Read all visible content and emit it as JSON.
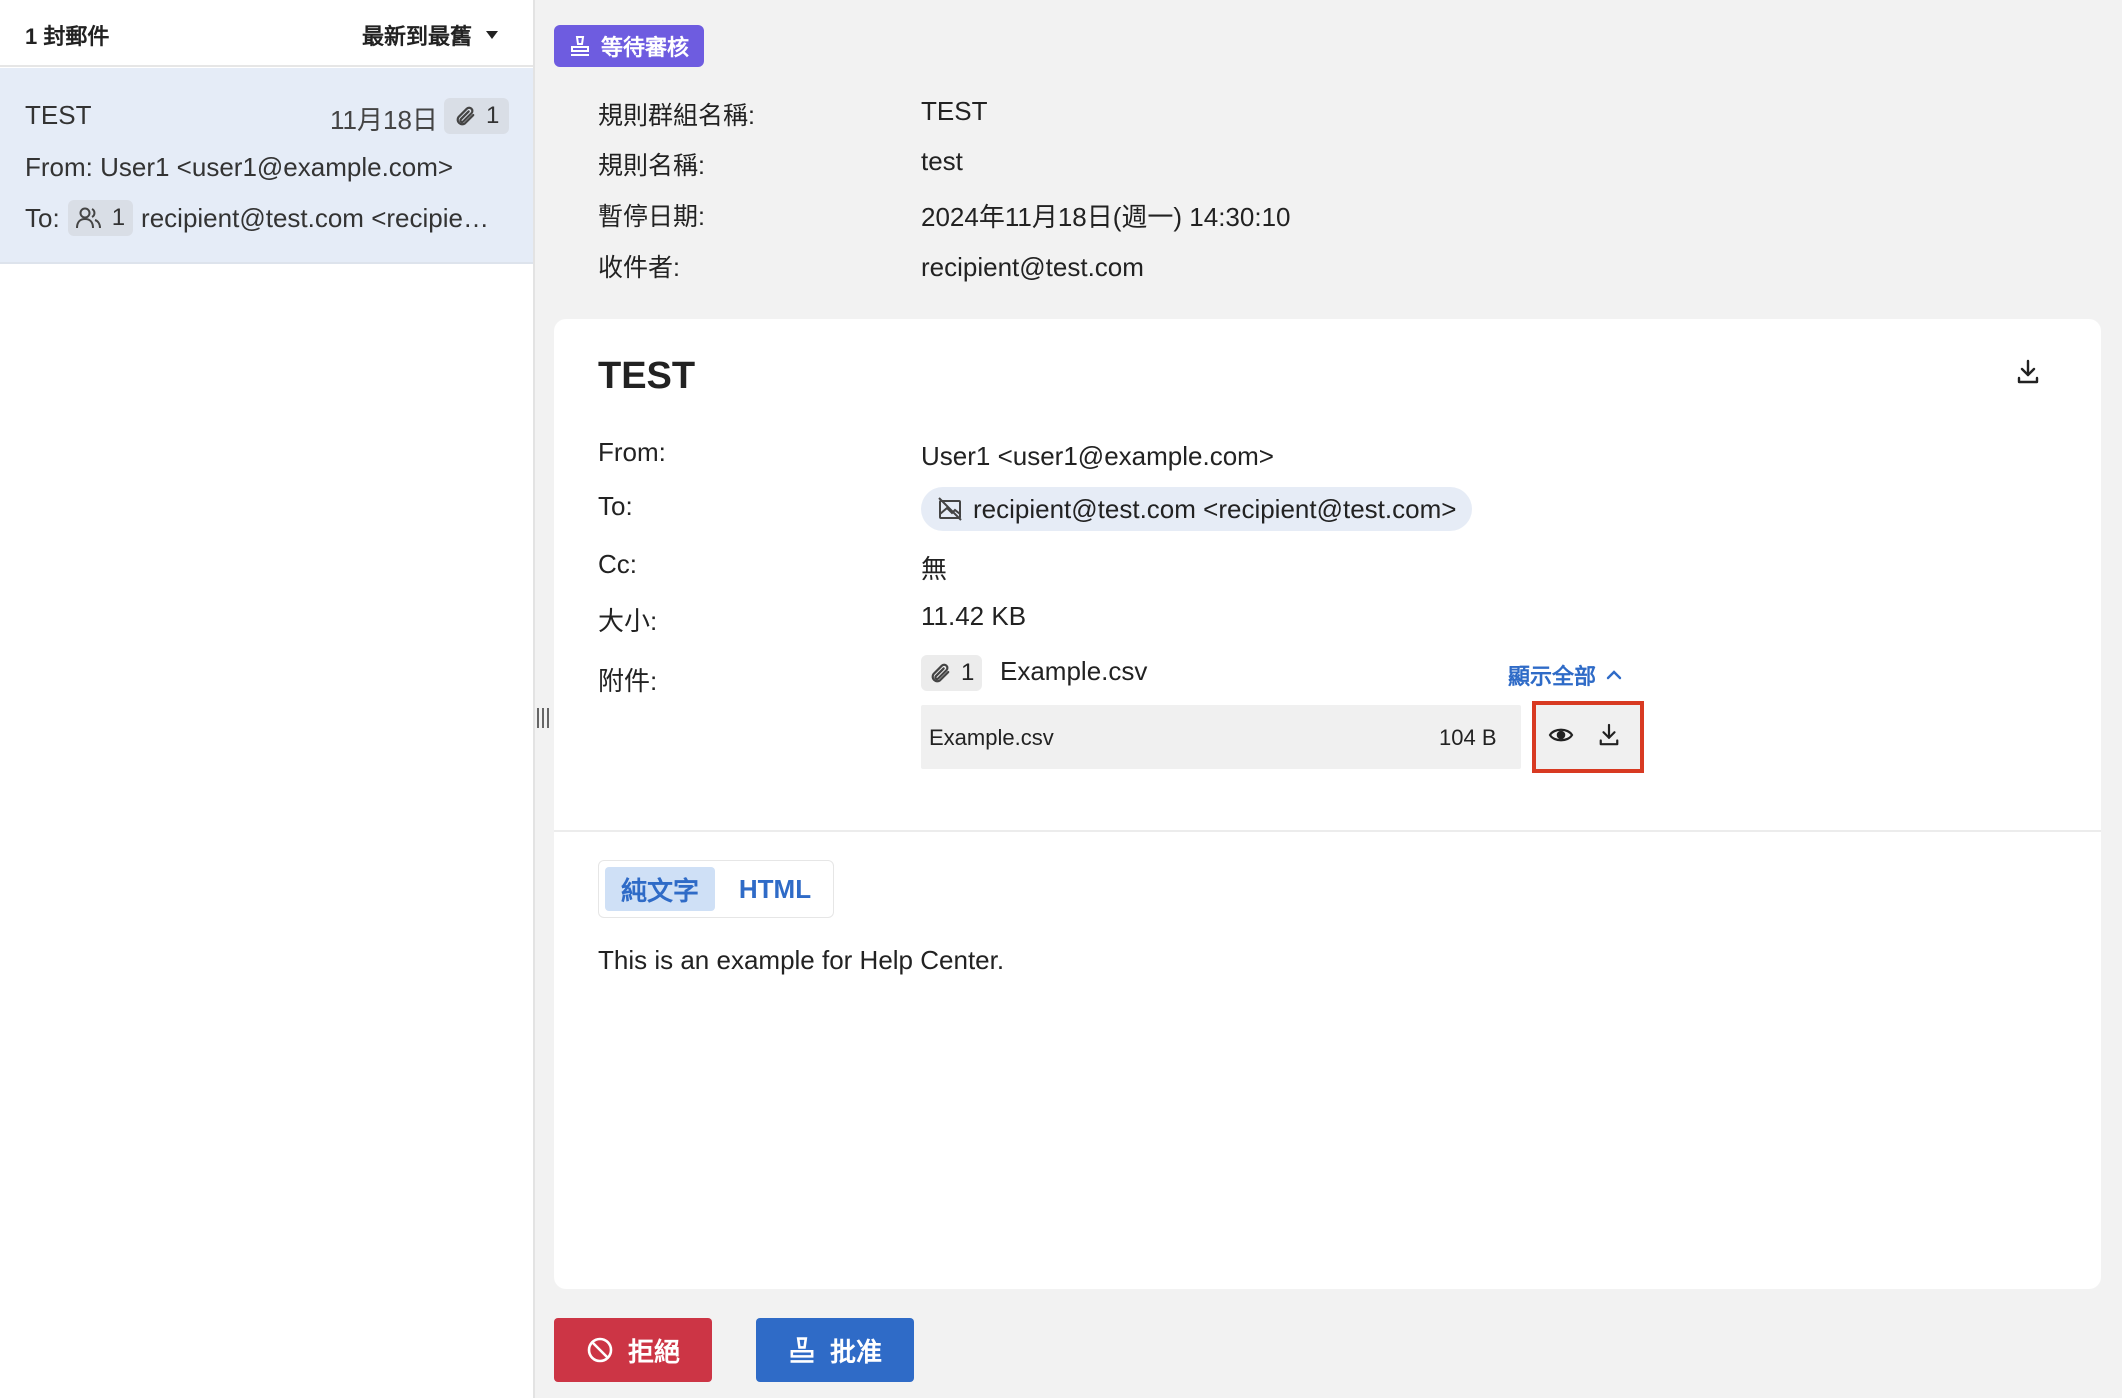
{
  "list": {
    "count_label": "1 封郵件",
    "sort_label": "最新到最舊",
    "items": [
      {
        "subject": "TEST",
        "date": "11月18日",
        "attachment_count": "1",
        "from": "From: User1 <user1@example.com>",
        "to_label": "To:",
        "recipient_count": "1",
        "to": "recipient@test.com <recipient@test.com>"
      }
    ]
  },
  "status": {
    "label": "等待審核",
    "color": "#6e5ce0"
  },
  "meta": {
    "rule_group_label": "規則群組名稱:",
    "rule_group": "TEST",
    "rule_name_label": "規則名稱:",
    "rule_name": "test",
    "paused_label": "暫停日期:",
    "paused_date": "2024年11月18日(週一) 14:30:10",
    "recipient_label": "收件者:",
    "recipient": "recipient@test.com"
  },
  "message": {
    "subject": "TEST",
    "from_label": "From:",
    "from": "User1 <user1@example.com>",
    "to_label": "To:",
    "to": "recipient@test.com <recipient@test.com>",
    "cc_label": "Cc:",
    "cc": "無",
    "size_label": "大小:",
    "size": "11.42 KB",
    "attachments_label": "附件:",
    "attachment_count": "1",
    "attachment_summary": "Example.csv",
    "show_all_label": "顯示全部",
    "attachments": [
      {
        "name": "Example.csv",
        "size": "104 B"
      }
    ],
    "tabs": {
      "plain": "純文字",
      "html": "HTML",
      "active": "plain"
    },
    "body": "This is an example for Help Center."
  },
  "actions": {
    "reject_label": "拒絕",
    "approve_label": "批准",
    "reject_color": "#cc3545",
    "approve_color": "#2f6bc7"
  },
  "highlight_color": "#d83a22",
  "icons": [
    "chevron-down-icon",
    "paperclip-icon",
    "users-icon",
    "stamp-icon",
    "download-icon",
    "no-image-icon",
    "chevron-up-icon",
    "eye-icon",
    "ban-icon"
  ]
}
